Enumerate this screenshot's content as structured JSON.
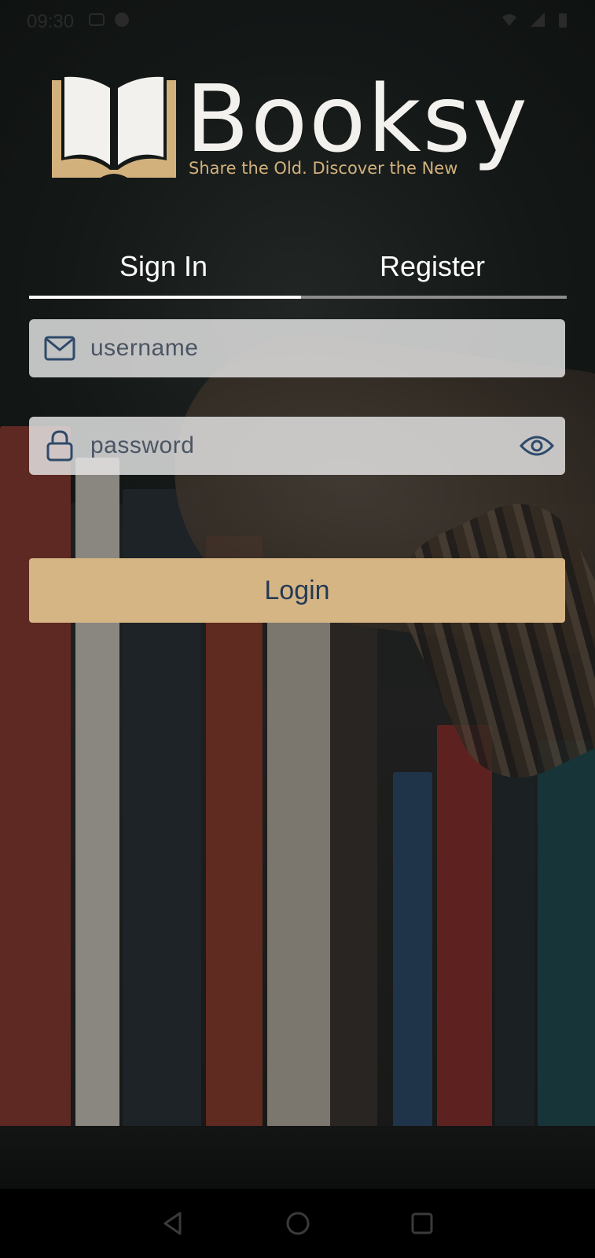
{
  "status_bar": {
    "time": "09:30",
    "icons": [
      "notification-icon",
      "alert-icon",
      "wifi-icon",
      "signal-icon",
      "battery-icon"
    ]
  },
  "brand": {
    "name": "Booksy",
    "tagline": "Share the Old. Discover the New",
    "colors": {
      "gold": "#d6b584",
      "white": "#f3f1ed"
    }
  },
  "tabs": [
    {
      "label": "Sign In",
      "active": true
    },
    {
      "label": "Register",
      "active": false
    }
  ],
  "form": {
    "username": {
      "placeholder": "username",
      "value": ""
    },
    "password": {
      "placeholder": "password",
      "value": ""
    },
    "login_label": "Login"
  },
  "nav": {
    "icons": [
      "back-icon",
      "home-icon",
      "recents-icon"
    ]
  },
  "colors": {
    "accent": "#d6b584",
    "field_bg": "#e8e8e8",
    "icon": "#2f4a6b"
  }
}
